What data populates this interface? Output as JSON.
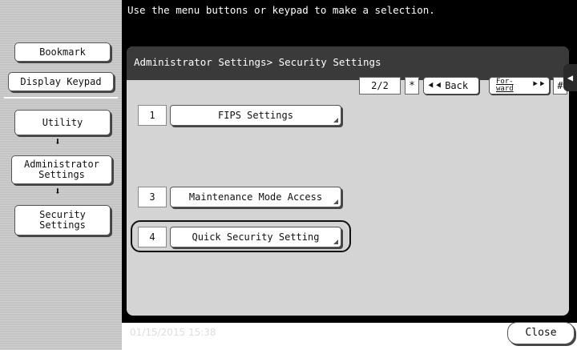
{
  "sidebar": {
    "bookmark_label": "Bookmark",
    "display_keypad_label": "Display Keypad",
    "path": [
      {
        "label": "Utility"
      },
      {
        "label": "Administrator\nSettings"
      },
      {
        "label": "Security\nSettings"
      }
    ],
    "arrow_glyph": "⬇"
  },
  "topbar": {
    "message": "Use the menu buttons or keypad to make a selection."
  },
  "panel": {
    "breadcrumb": "Administrator Settings> Security Settings",
    "page_indicator": "2/2",
    "star_label": "*",
    "back_label": "Back",
    "forward_label": "For-\nward",
    "hash_label": "#",
    "collapse_glyph": "◀"
  },
  "items": [
    {
      "number": "1",
      "label": "FIPS Settings"
    },
    {
      "number": "3",
      "label": "Maintenance Mode Access"
    },
    {
      "number": "4",
      "label": "Quick Security Setting"
    }
  ],
  "footer": {
    "datetime": "01/15/2015  15:38",
    "close_label": "Close"
  }
}
